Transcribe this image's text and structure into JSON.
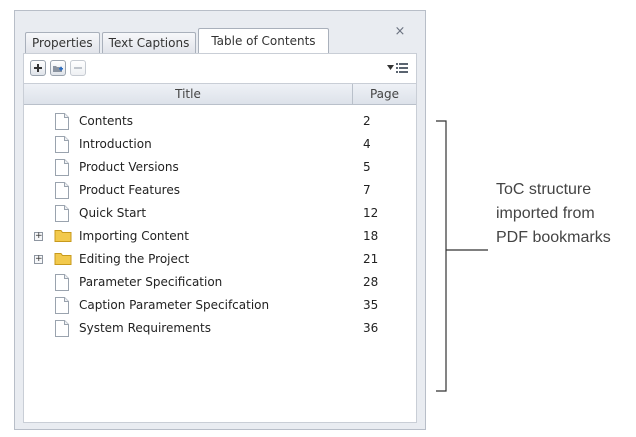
{
  "tabs": [
    {
      "label": "Properties"
    },
    {
      "label": "Text Captions"
    },
    {
      "label": "Table of Contents"
    }
  ],
  "close_glyph": "×",
  "toolbar": {
    "add_icon": "plus-icon",
    "add_folder_icon": "add-folder-icon",
    "remove_icon": "minus-icon",
    "view_menu_icon": "list-view-icon"
  },
  "columns": {
    "title": "Title",
    "page": "Page"
  },
  "rows": [
    {
      "title": "Contents",
      "page": "2",
      "type": "page"
    },
    {
      "title": "Introduction",
      "page": "4",
      "type": "page"
    },
    {
      "title": "Product Versions",
      "page": "5",
      "type": "page"
    },
    {
      "title": "Product Features",
      "page": "7",
      "type": "page"
    },
    {
      "title": "Quick Start",
      "page": "12",
      "type": "page"
    },
    {
      "title": "Importing Content",
      "page": "18",
      "type": "folder",
      "expander": "+"
    },
    {
      "title": "Editing the Project",
      "page": "21",
      "type": "folder",
      "expander": "+"
    },
    {
      "title": "Parameter Specification",
      "page": "28",
      "type": "page"
    },
    {
      "title": "Caption Parameter Specifcation",
      "page": "35",
      "type": "page"
    },
    {
      "title": "System Requirements",
      "page": "36",
      "type": "page"
    }
  ],
  "annotation": {
    "line1": "ToC structure",
    "line2": "imported from",
    "line3": "PDF bookmarks"
  },
  "colors": {
    "folder": "#f2c94c",
    "panel_bg": "#e9ecf1",
    "bracket": "#333333"
  }
}
